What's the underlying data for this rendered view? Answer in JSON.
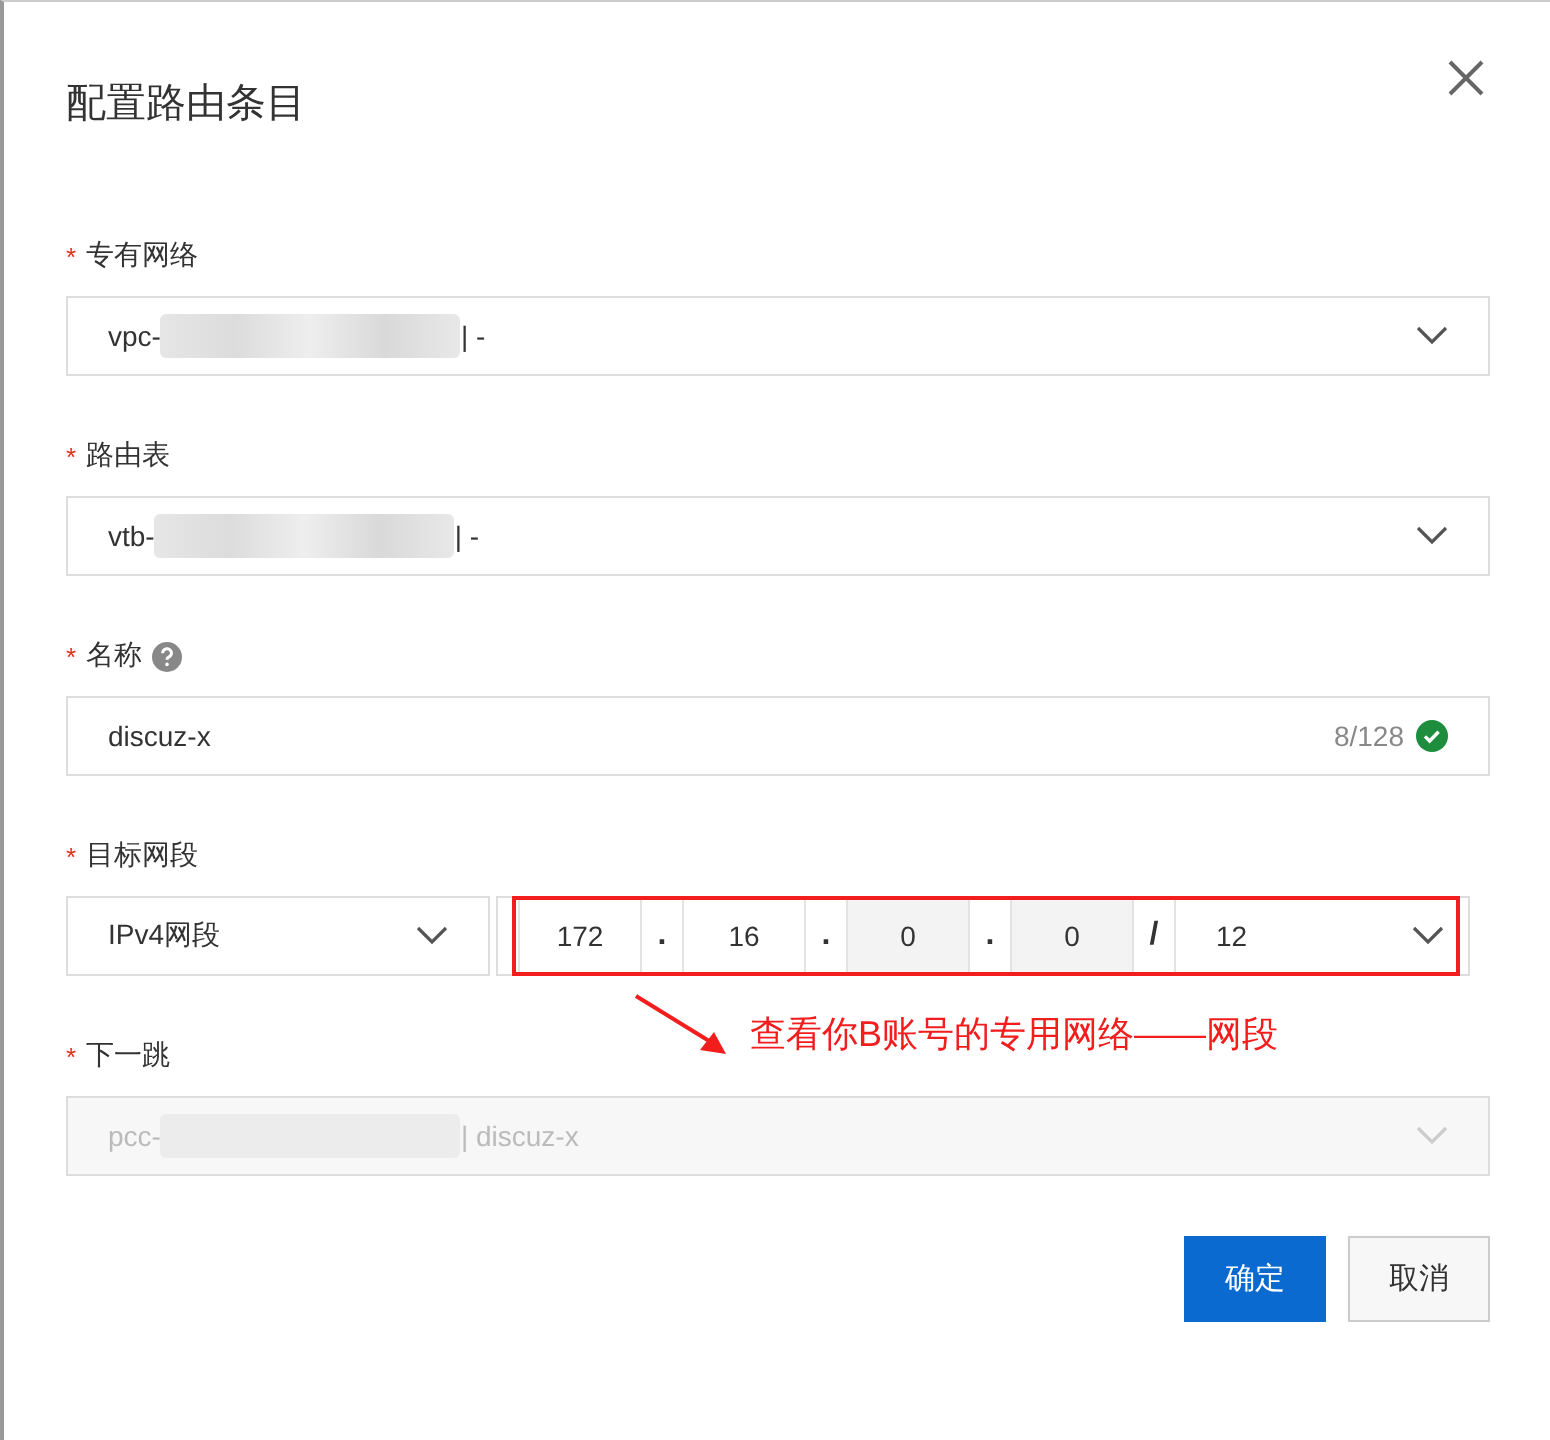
{
  "dialog": {
    "title": "配置路由条目"
  },
  "fields": [
    {
      "kind": "select",
      "required_mark": "*",
      "label": "专有网络",
      "prefix": "vpc-",
      "redacted": true,
      "suffix": "| -",
      "disabled": false
    },
    {
      "kind": "select",
      "required_mark": "*",
      "label": "路由表",
      "prefix": "vtb-",
      "redacted": true,
      "suffix": "| -",
      "disabled": false
    },
    {
      "kind": "text",
      "required_mark": "*",
      "label": "名称",
      "help": true,
      "value": "discuz-x",
      "counter": "8/128",
      "valid": true
    },
    {
      "kind": "cidr",
      "required_mark": "*",
      "label": "目标网段",
      "type_select": "IPv4网段",
      "highlighted": true,
      "parts": [
        {
          "kind": "octet",
          "value": "172",
          "disabled": false
        },
        {
          "kind": "sep",
          "text": "."
        },
        {
          "kind": "octet",
          "value": "16",
          "disabled": false
        },
        {
          "kind": "sep",
          "text": "."
        },
        {
          "kind": "octet",
          "value": "0",
          "disabled": true
        },
        {
          "kind": "sep",
          "text": "."
        },
        {
          "kind": "octet",
          "value": "0",
          "disabled": true
        },
        {
          "kind": "sep",
          "text": "/"
        },
        {
          "kind": "mask",
          "value": "12"
        }
      ]
    },
    {
      "kind": "select",
      "required_mark": "*",
      "label": "下一跳",
      "prefix": "pcc-",
      "redacted": true,
      "suffix": "| discuz-x",
      "disabled": true
    }
  ],
  "annotation": {
    "text": "查看你B账号的专用网络——网段"
  },
  "buttons": [
    {
      "label": "确定",
      "kind": "primary"
    },
    {
      "label": "取消",
      "kind": "default"
    }
  ]
}
